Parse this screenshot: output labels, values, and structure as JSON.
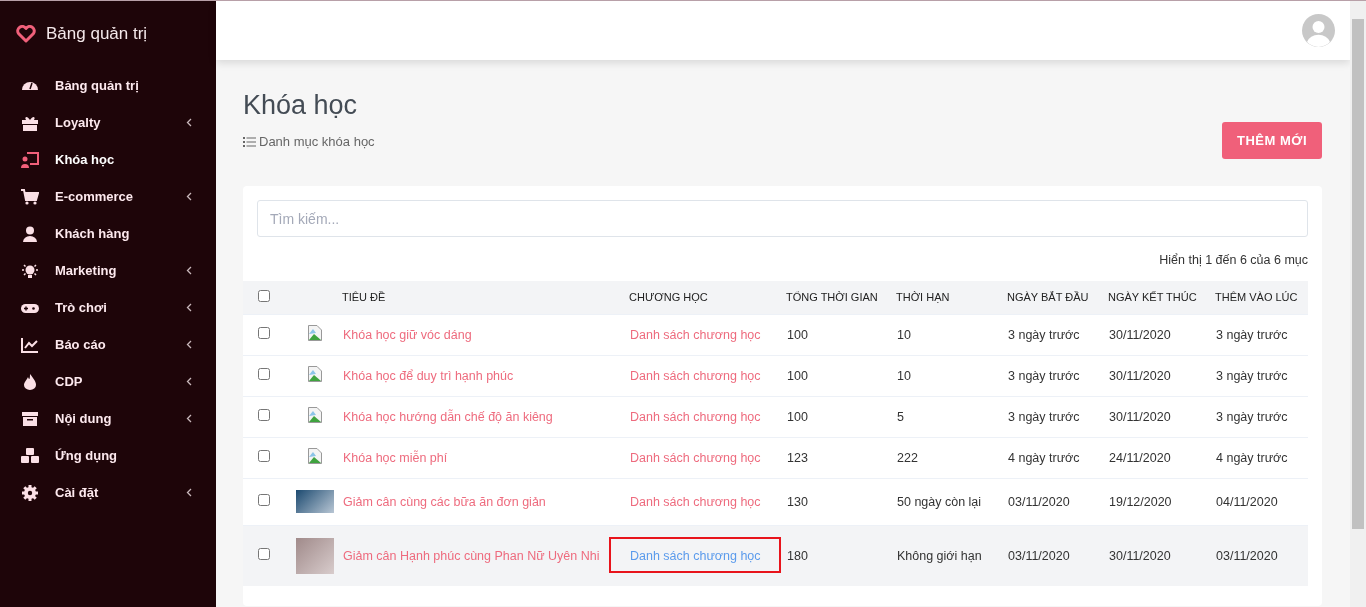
{
  "sidebar": {
    "brand": "Bảng quản trị",
    "items": [
      {
        "label": "Bảng quản trị",
        "selected": false,
        "has_submenu": false
      },
      {
        "label": "Loyalty",
        "selected": false,
        "has_submenu": true
      },
      {
        "label": "Khóa học",
        "selected": true,
        "has_submenu": false
      },
      {
        "label": "E-commerce",
        "selected": false,
        "has_submenu": true
      },
      {
        "label": "Khách hàng",
        "selected": false,
        "has_submenu": false
      },
      {
        "label": "Marketing",
        "selected": false,
        "has_submenu": true
      },
      {
        "label": "Trò chơi",
        "selected": false,
        "has_submenu": true
      },
      {
        "label": "Báo cáo",
        "selected": false,
        "has_submenu": true
      },
      {
        "label": "CDP",
        "selected": false,
        "has_submenu": true
      },
      {
        "label": "Nội dung",
        "selected": false,
        "has_submenu": true
      },
      {
        "label": "Ứng dụng",
        "selected": false,
        "has_submenu": false
      },
      {
        "label": "Cài đặt",
        "selected": false,
        "has_submenu": true
      }
    ]
  },
  "page": {
    "title": "Khóa học",
    "breadcrumb": "Danh mục khóa học",
    "add_button": "THÊM MỚI"
  },
  "search": {
    "placeholder": "Tìm kiếm..."
  },
  "summary": "Hiển thị 1 đến 6 của 6 mục",
  "table": {
    "select_all_checked": false,
    "columns": [
      "TIÊU ĐỀ",
      "CHƯƠNG HỌC",
      "TỔNG THỜI GIAN",
      "THỜI HẠN",
      "NGÀY BẮT ĐẦU",
      "NGÀY KẾT THÚC",
      "THÊM VÀO LÚC"
    ],
    "rows": [
      {
        "checked": false,
        "highlighted": false,
        "annotated": false,
        "kind": "broken",
        "title": "Khóa học giữ vóc dáng",
        "chapters": "Danh sách chương học",
        "total": "100",
        "duration": "10",
        "start": "3 ngày trước",
        "end": "30/11/2020",
        "added": "3 ngày trước"
      },
      {
        "checked": false,
        "highlighted": false,
        "annotated": false,
        "kind": "broken",
        "title": "Khóa học để duy trì hạnh phúc",
        "chapters": "Danh sách chương học",
        "total": "100",
        "duration": "10",
        "start": "3 ngày trước",
        "end": "30/11/2020",
        "added": "3 ngày trước"
      },
      {
        "checked": false,
        "highlighted": false,
        "annotated": false,
        "kind": "broken",
        "title": "Khóa học hướng dẫn chế độ ăn kiêng",
        "chapters": "Danh sách chương học",
        "total": "100",
        "duration": "5",
        "start": "3 ngày trước",
        "end": "30/11/2020",
        "added": "3 ngày trước"
      },
      {
        "checked": false,
        "highlighted": false,
        "annotated": false,
        "kind": "broken",
        "title": "Khóa học miễn phí",
        "chapters": "Danh sách chương học",
        "total": "123",
        "duration": "222",
        "start": "4 ngày trước",
        "end": "24/11/2020",
        "added": "4 ngày trước"
      },
      {
        "checked": false,
        "highlighted": false,
        "annotated": false,
        "kind": "photo",
        "title": "Giảm cân cùng các bữa ăn đơn giản",
        "chapters": "Danh sách chương học",
        "total": "130",
        "duration": "50 ngày còn lại",
        "start": "03/11/2020",
        "end": "19/12/2020",
        "added": "04/11/2020"
      },
      {
        "checked": false,
        "highlighted": true,
        "annotated": true,
        "kind": "photo",
        "title": "Giảm cân Hạnh phúc cùng Phan Nữ Uyên Nhi",
        "chapters": "Danh sách chương học",
        "total": "180",
        "duration": "Không giới hạn",
        "start": "03/11/2020",
        "end": "30/11/2020",
        "added": "03/11/2020"
      }
    ]
  }
}
